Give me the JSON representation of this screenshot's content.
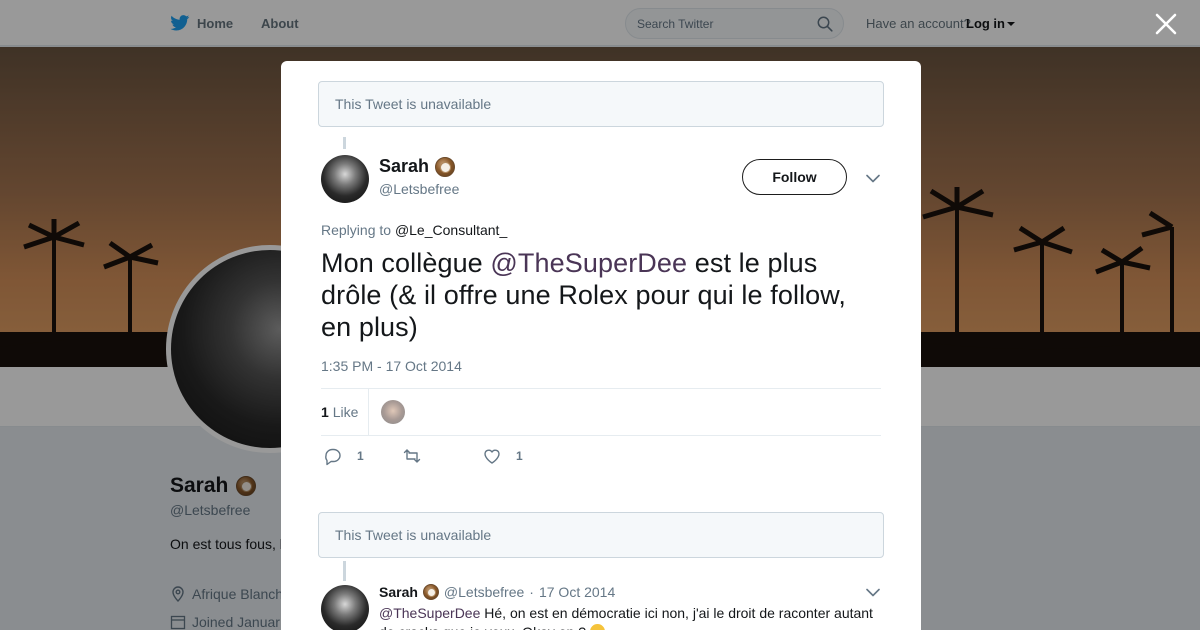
{
  "topbar": {
    "home_label": "Home",
    "about_label": "About",
    "search_placeholder": "Search Twitter",
    "have_account": "Have an account?",
    "login_label": "Log in"
  },
  "profile": {
    "name": "Sarah",
    "handle": "@Letsbefree",
    "bio": "On est tous fous, bien que vous.",
    "location": "Afrique Blanch",
    "joined": "Joined Januar"
  },
  "modal": {
    "unavailable_text": "This Tweet is unavailable",
    "tweet": {
      "author_name": "Sarah",
      "author_handle": "@Letsbefree",
      "follow_label": "Follow",
      "replying_prefix": "Replying to",
      "replying_to": "@Le_Consultant_",
      "text_before": "Mon collègue ",
      "text_mention": "@TheSuperDee",
      "text_after": " est le plus drôle (& il offre une Rolex pour qui le follow, en plus)",
      "timestamp": "1:35 PM - 17 Oct 2014",
      "likes_number": "1",
      "likes_label": "Like",
      "replies_count": "1",
      "retweets_count": "",
      "likes_action_count": "1"
    },
    "second_unavailable_text": "This Tweet is unavailable",
    "reply": {
      "author_name": "Sarah",
      "author_handle": "@Letsbefree",
      "separator": "·",
      "date": "17 Oct 2014",
      "mention": "@TheSuperDee",
      "text": " Hé, on est en démocratie ici non, j'ai le droit de raconter autant de cracks que je veux. Okay on ?"
    }
  },
  "colors": {
    "twitter_blue": "#1da1f2",
    "overlay": "rgba(0,0,0,0.4)",
    "mention": "#4a3556"
  }
}
